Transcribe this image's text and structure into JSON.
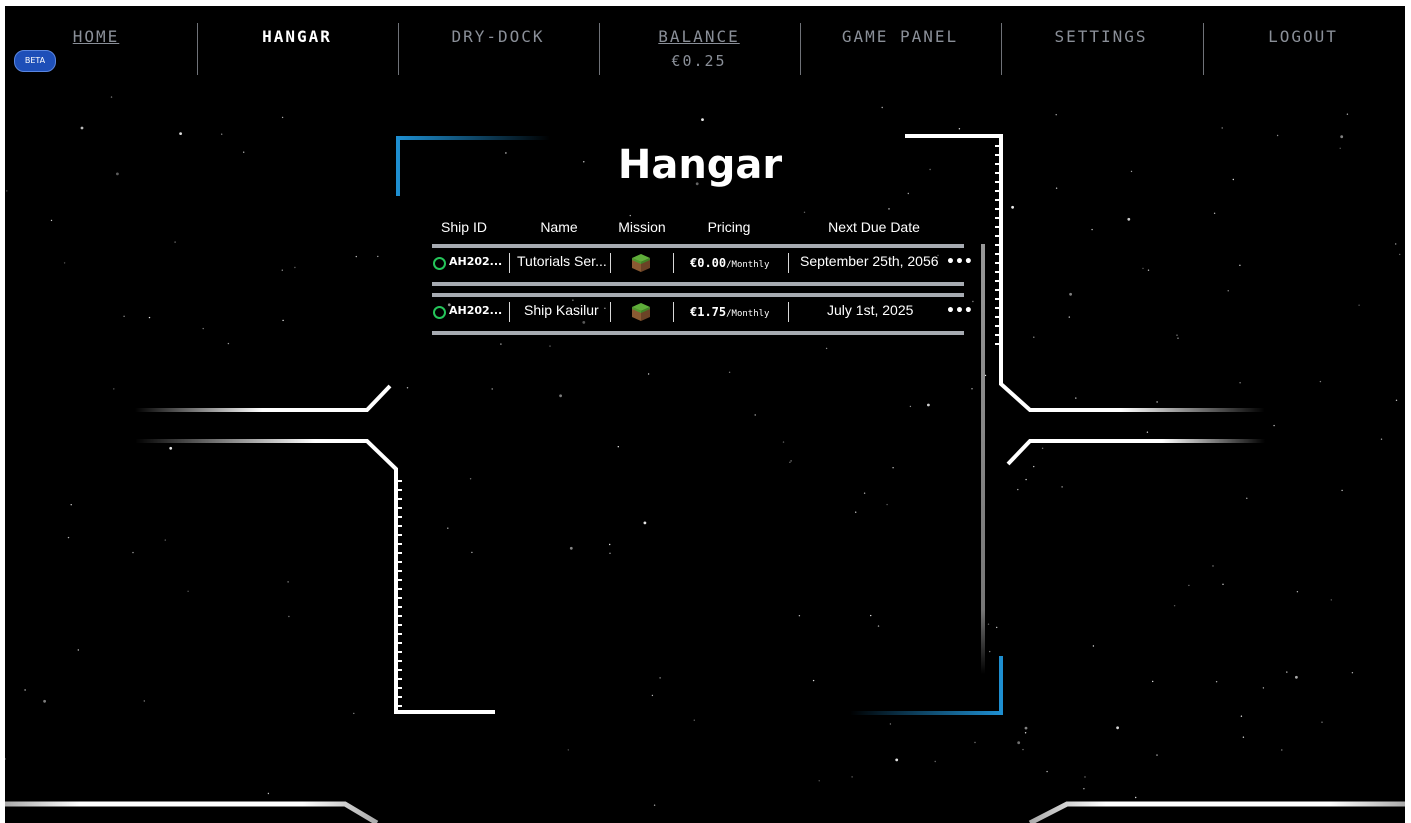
{
  "nav": {
    "items": [
      {
        "label": "HOME",
        "style": "link"
      },
      {
        "label": "HANGAR",
        "style": "active"
      },
      {
        "label": "DRY-DOCK",
        "style": "plain"
      },
      {
        "label": "BALANCE",
        "style": "link",
        "sub": "€0.25"
      },
      {
        "label": "GAME PANEL",
        "style": "plain"
      },
      {
        "label": "SETTINGS",
        "style": "plain"
      },
      {
        "label": "LOGOUT",
        "style": "plain"
      }
    ],
    "beta_badge": "BETA"
  },
  "hangar": {
    "title": "Hangar",
    "columns": [
      "Ship ID",
      "Name",
      "Mission",
      "Pricing",
      "Next Due Date"
    ],
    "rows": [
      {
        "ship_id": "AH202...",
        "status": "online",
        "name": "Tutorials Ser...",
        "mission_icon": "grass-block-icon",
        "price": "€0.00",
        "period": "/Monthly",
        "next_due": "September 25th, 2056",
        "more": "•••"
      },
      {
        "ship_id": "AH202...",
        "status": "online",
        "name": "Ship Kasilur",
        "mission_icon": "grass-block-icon",
        "price": "€1.75",
        "period": "/Monthly",
        "next_due": "July 1st, 2025",
        "more": "•••"
      }
    ]
  },
  "colors": {
    "background": "#000000",
    "accent_blue": "#1e8fd1",
    "status_green": "#25c55a",
    "nav_text": "#8a8f98",
    "beta_badge": "#1e4fb8"
  }
}
